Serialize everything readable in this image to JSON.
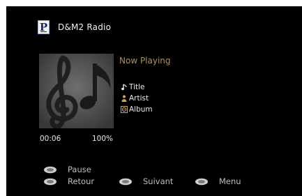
{
  "header": {
    "title": "D&M2 Radio",
    "logo_letter": "P"
  },
  "now_playing": {
    "heading": "Now Playing",
    "title": "Title",
    "artist": "Artist",
    "album": "Album"
  },
  "playback": {
    "time": "00:06",
    "buffer": "100%"
  },
  "controls": [
    {
      "label": "Pause"
    },
    {
      "label": "Retour"
    },
    {
      "label": "Suivant"
    },
    {
      "label": "Menu"
    }
  ],
  "colors": {
    "background": "#000000",
    "accent": "#a98f6a",
    "text": "#e8e8e8",
    "control_text": "#bdbdbd"
  },
  "icons": {
    "logo": "p-logo-icon",
    "title": "music-note-icon",
    "artist": "person-icon",
    "album": "album-icon",
    "controls": "remote-button-icon"
  }
}
